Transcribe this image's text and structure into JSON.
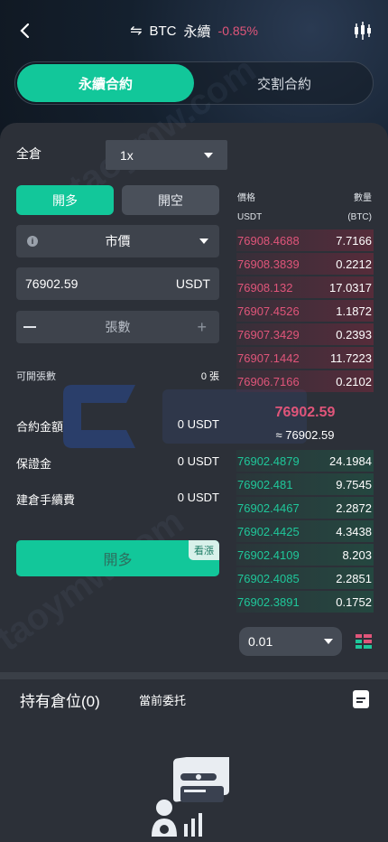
{
  "header": {
    "pair": "BTC",
    "contract_type": "永續",
    "change": "-0.85%"
  },
  "tabs": [
    {
      "label": "永續合約",
      "active": true
    },
    {
      "label": "交割合約",
      "active": false
    }
  ],
  "form": {
    "margin_mode": "全倉",
    "leverage": "1x",
    "buy_label": "開多",
    "sell_label": "開空",
    "order_type": "市價",
    "price_value": "76902.59",
    "price_unit": "USDT",
    "qty_placeholder": "張數",
    "available_label": "可開張數",
    "available_value": "0 張",
    "contract_amount_label": "合約金額",
    "contract_amount_value": "0 USDT",
    "margin_label": "保證金",
    "margin_value": "0 USDT",
    "fee_label": "建倉手續費",
    "fee_value": "0 USDT",
    "submit_label": "開多",
    "submit_tag": "看漲"
  },
  "orderbook": {
    "price_header": "價格",
    "price_unit": "USDT",
    "qty_header": "數量",
    "qty_unit": "(BTC)",
    "asks": [
      {
        "price": "76908.4688",
        "qty": "7.7166"
      },
      {
        "price": "76908.3839",
        "qty": "0.2212"
      },
      {
        "price": "76908.132",
        "qty": "17.0317"
      },
      {
        "price": "76907.4526",
        "qty": "1.1872"
      },
      {
        "price": "76907.3429",
        "qty": "0.2393"
      },
      {
        "price": "76907.1442",
        "qty": "11.7223"
      },
      {
        "price": "76906.7166",
        "qty": "0.2102"
      }
    ],
    "last_price": "76902.59",
    "last_price_approx": "≈ 76902.59",
    "bids": [
      {
        "price": "76902.4879",
        "qty": "24.1984"
      },
      {
        "price": "76902.481",
        "qty": "9.7545"
      },
      {
        "price": "76902.4467",
        "qty": "2.2872"
      },
      {
        "price": "76902.4425",
        "qty": "4.3438"
      },
      {
        "price": "76902.4109",
        "qty": "8.203"
      },
      {
        "price": "76902.4085",
        "qty": "2.2851"
      },
      {
        "price": "76902.3891",
        "qty": "0.1752"
      }
    ],
    "depth": "0.01"
  },
  "positions": {
    "title": "持有倉位(0)",
    "current_orders": "當前委托"
  },
  "watermark": {
    "text": "taoymw.com"
  },
  "colors": {
    "accent": "#12c79a",
    "ask": "#e0557a",
    "bid": "#1fc79a",
    "panel": "#2c3038"
  }
}
